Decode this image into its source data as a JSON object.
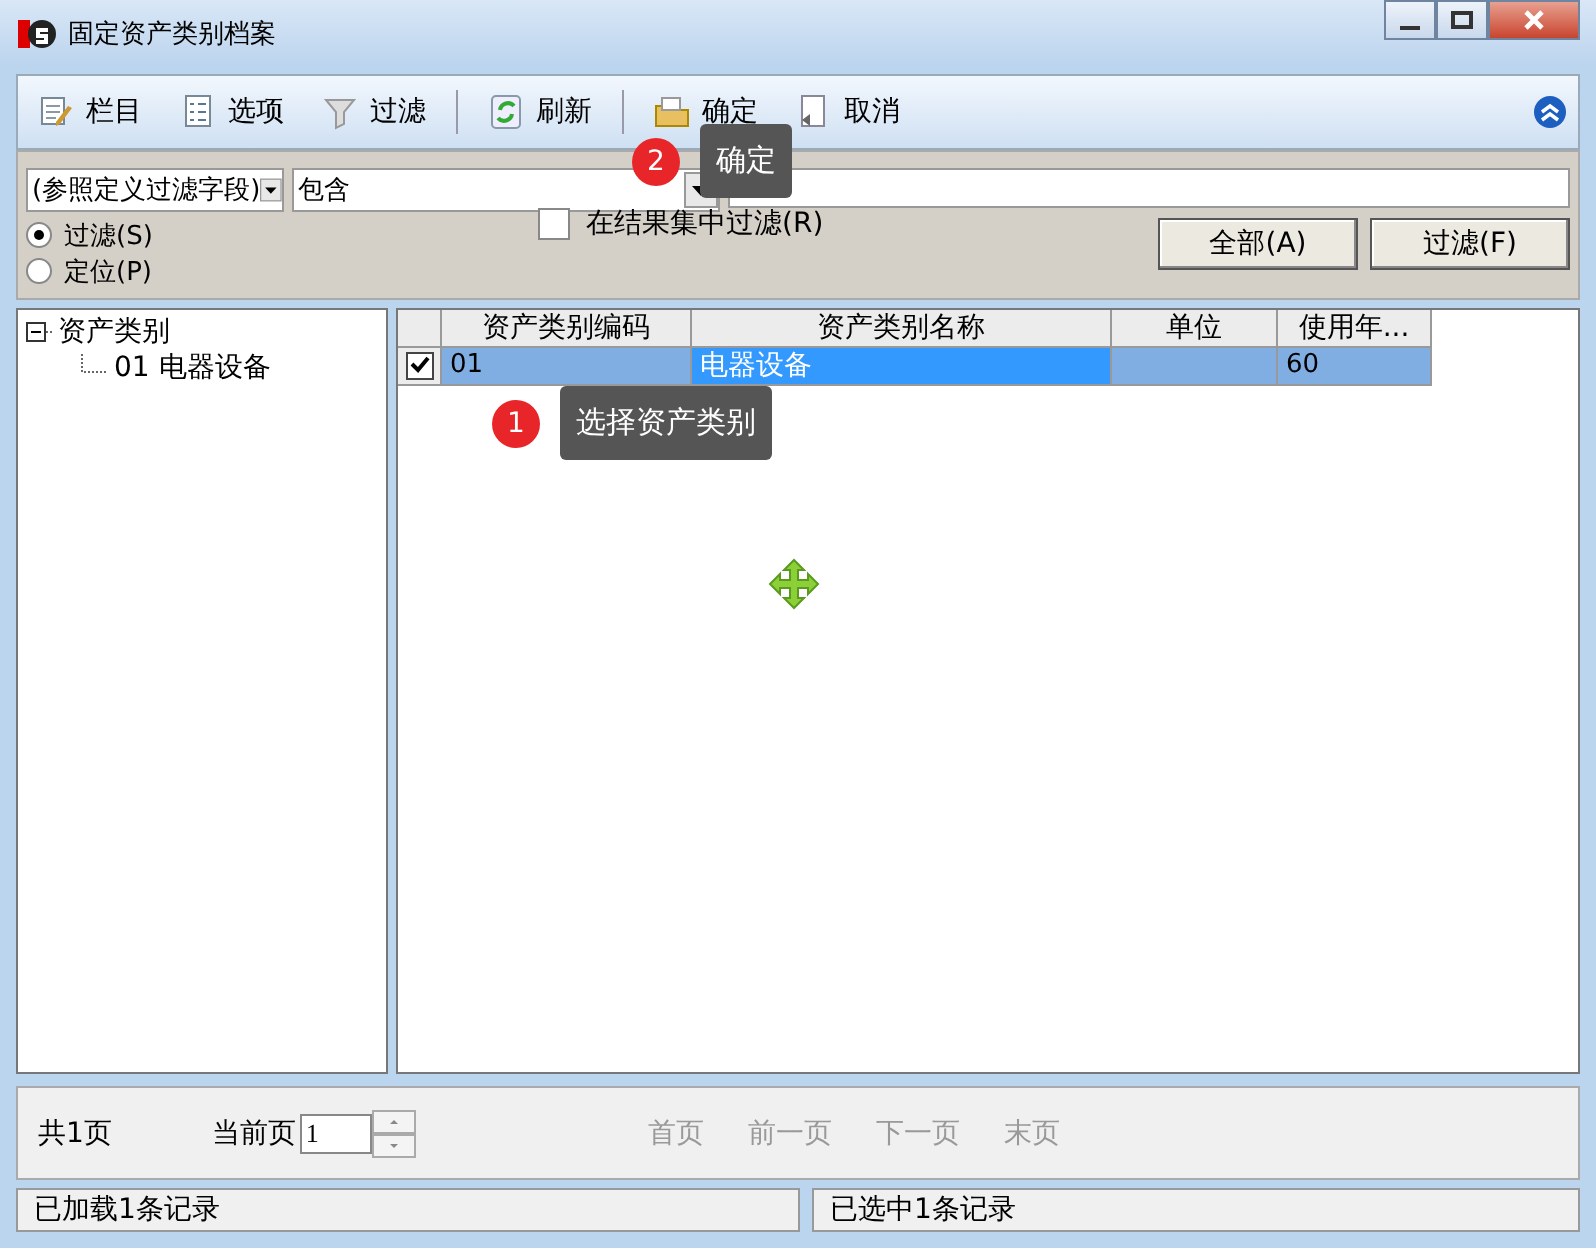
{
  "window": {
    "title": "固定资产类别档案"
  },
  "toolbar": [
    {
      "label": "栏目",
      "separator_before": false
    },
    {
      "label": "选项",
      "separator_before": false
    },
    {
      "label": "过滤",
      "separator_before": false
    },
    {
      "label": "刷新",
      "separator_before": true
    },
    {
      "label": "确定",
      "separator_before": true
    },
    {
      "label": "取消",
      "separator_before": false
    }
  ],
  "filter": {
    "field": "(参照定义过滤字段)",
    "operator": "包含",
    "modes": [
      {
        "label": "过滤(S)",
        "selected": true
      },
      {
        "label": "定位(P)",
        "selected": false
      }
    ],
    "in_results": {
      "label": "在结果集中过滤(R)",
      "checked": false
    },
    "buttons": [
      "全部(A)",
      "过滤(F)"
    ]
  },
  "tree": {
    "label": "资产类别",
    "expanded": true,
    "children": [
      {
        "label": "01 电器设备"
      }
    ]
  },
  "table": {
    "columns": [
      "资产类别编码",
      "资产类别名称",
      "单位",
      "使用年..."
    ],
    "rows": [
      {
        "checked": true,
        "selected": true,
        "code": "01",
        "name": "电器设备",
        "years": "60"
      }
    ]
  },
  "pager": {
    "total": "共1页",
    "current_label": "当前页",
    "page": "1",
    "nav": [
      {
        "label": "首页",
        "disabled": true
      },
      {
        "label": "前一页",
        "disabled": true
      },
      {
        "label": "下一页",
        "disabled": true
      },
      {
        "label": "末页",
        "disabled": true
      }
    ]
  },
  "status_bar": [
    "已加载1条记录",
    "已选中1条记录"
  ],
  "callouts": [
    {
      "number": "2",
      "text": "确定"
    },
    {
      "number": "1",
      "text": "选择资产类别"
    }
  ]
}
